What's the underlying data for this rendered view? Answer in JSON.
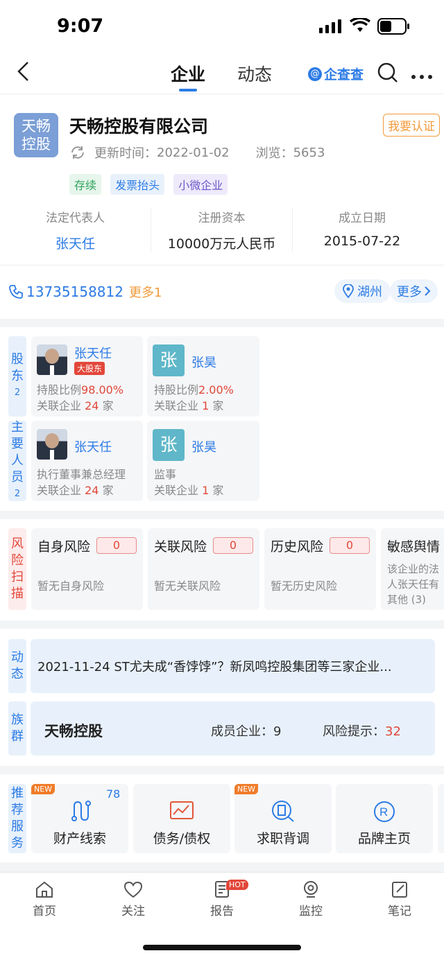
{
  "status_bar": {
    "time": "9:07"
  },
  "header": {
    "tabs": [
      "企业",
      "动态"
    ],
    "brand": "企查查"
  },
  "company": {
    "logo_text_line1": "天畅",
    "logo_text_line2": "控股",
    "name": "天畅控股有限公司",
    "verify_label": "我要认证",
    "updated_label": "更新时间：",
    "updated_value": "2022-01-02",
    "views_label": "浏览：",
    "views_value": "5653",
    "tags": [
      "存续",
      "发票抬头",
      "小微企业"
    ]
  },
  "key_info": [
    {
      "label": "法定代表人",
      "value": "张天任"
    },
    {
      "label": "注册资本",
      "value": "10000万元人民币"
    },
    {
      "label": "成立日期",
      "value": "2015-07-22"
    }
  ],
  "contact": {
    "phone": "13735158812",
    "more_phones": "更多1",
    "location": "湖州",
    "more": "更多"
  },
  "shareholders": {
    "label_chars": [
      "股",
      "东"
    ],
    "count": "2",
    "items": [
      {
        "name": "张天任",
        "badge": "大股东",
        "ratio_label": "持股比例",
        "ratio": "98.00%",
        "related_label": "关联企业",
        "related_count": "24",
        "related_unit": "家"
      },
      {
        "name": "张昊",
        "avatar_char": "张",
        "ratio_label": "持股比例",
        "ratio": "2.00%",
        "related_label": "关联企业",
        "related_count": "1",
        "related_unit": "家"
      }
    ]
  },
  "personnel": {
    "label_chars": [
      "主",
      "要",
      "人",
      "员"
    ],
    "count": "2",
    "items": [
      {
        "name": "张天任",
        "role": "执行董事兼总经理",
        "related_label": "关联企业",
        "related_count": "24",
        "related_unit": "家"
      },
      {
        "name": "张昊",
        "avatar_char": "张",
        "role": "监事",
        "related_label": "关联企业",
        "related_count": "1",
        "related_unit": "家"
      }
    ]
  },
  "risk": {
    "label_chars": [
      "风",
      "险",
      "扫",
      "描"
    ],
    "cards": [
      {
        "title": "自身风险",
        "count": "0",
        "desc": "暂无自身风险"
      },
      {
        "title": "关联风险",
        "count": "0",
        "desc": "暂无关联风险"
      },
      {
        "title": "历史风险",
        "count": "0",
        "desc": "暂无历史风险"
      }
    ],
    "sentiment": {
      "title": "敏感舆情",
      "line1": "该企业的法",
      "line2": "人张天任有",
      "line3": "其他 (3)"
    }
  },
  "news": {
    "label_chars": [
      "动",
      "态"
    ],
    "text": "2021-11-24 ST尤夫成“香饽饽”？新凤鸣控股集团等三家企业..."
  },
  "group": {
    "label_chars": [
      "族",
      "群"
    ],
    "name": "天畅控股",
    "members_label": "成员企业：",
    "members_value": "9",
    "risk_label": "风险提示：",
    "risk_value": "32"
  },
  "services": {
    "label_chars": [
      "推",
      "荐",
      "服",
      "务"
    ],
    "items": [
      {
        "label": "财产线索",
        "badge": "NEW",
        "count": "78"
      },
      {
        "label": "债务/债权"
      },
      {
        "label": "求职背调",
        "badge": "NEW"
      },
      {
        "label": "品牌主页"
      }
    ]
  },
  "bottom_nav": [
    {
      "label": "首页"
    },
    {
      "label": "关注"
    },
    {
      "label": "报告",
      "badge": "HOT"
    },
    {
      "label": "监控"
    },
    {
      "label": "笔记"
    }
  ],
  "colors": {
    "accent": "#2c7be5",
    "risk": "#e2473a",
    "verify": "#f29a3b"
  }
}
